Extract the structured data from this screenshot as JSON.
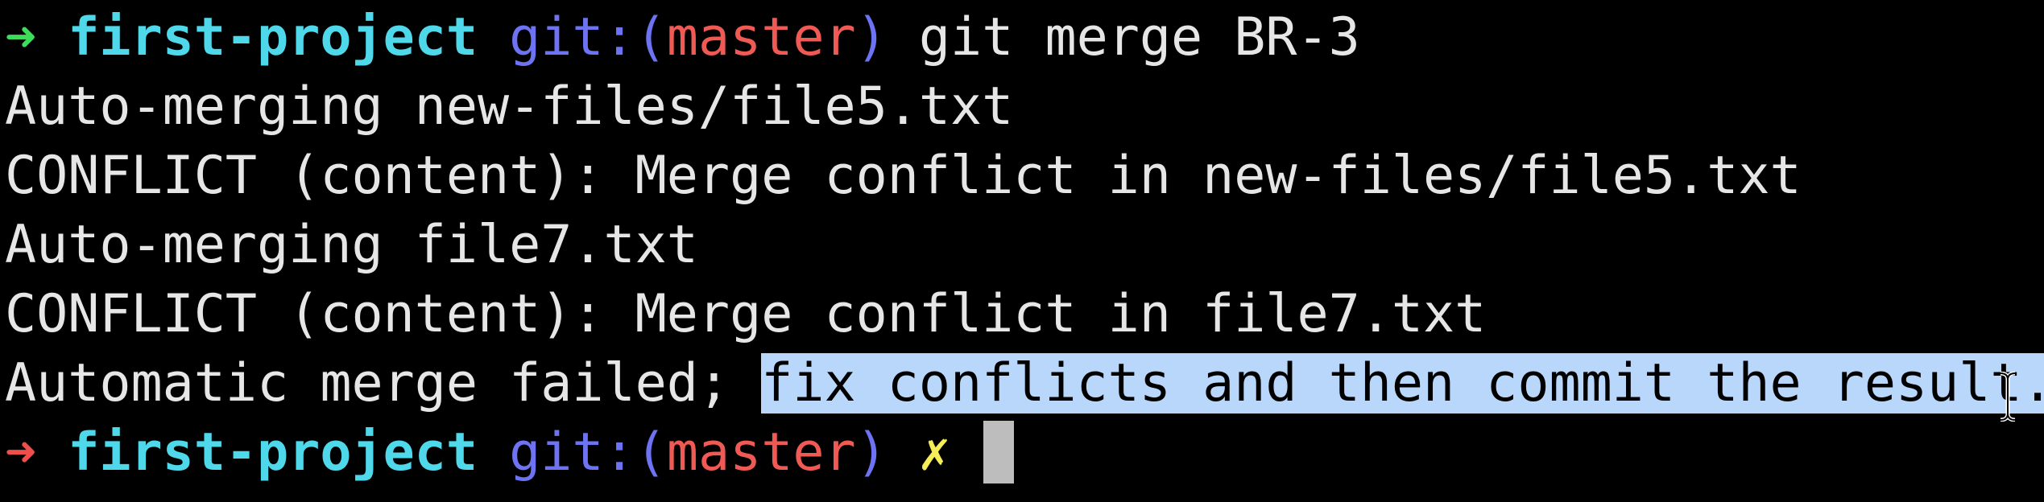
{
  "prompt1": {
    "arrow": "➜",
    "project": "first-project",
    "git_open": "git:(",
    "branch": "master",
    "git_close": ")",
    "command": "git merge BR-3"
  },
  "output": [
    "Auto-merging new-files/file5.txt",
    "CONFLICT (content): Merge conflict in new-files/file5.txt",
    "Auto-merging file7.txt",
    "CONFLICT (content): Merge conflict in file7.txt"
  ],
  "final_line": {
    "prefix": "Automatic merge failed; ",
    "selected": "fix conflicts and then commit the result."
  },
  "prompt2": {
    "arrow": "➜",
    "project": "first-project",
    "git_open": "git:(",
    "branch": "master",
    "git_close": ")",
    "dirty_marker": "✗"
  },
  "colors": {
    "background": "#000000",
    "success_arrow": "#3ddc59",
    "error_arrow": "#ef4f4a",
    "project": "#4fd8ea",
    "git_keyword": "#6d73f2",
    "branch": "#ef5a55",
    "dirty_marker": "#f5ee58",
    "selection": "#b8d7fb"
  },
  "icons": {
    "prompt_success": "right-arrow-icon",
    "prompt_error": "right-arrow-icon",
    "mouse_pointer": "i-beam-cursor-icon"
  }
}
